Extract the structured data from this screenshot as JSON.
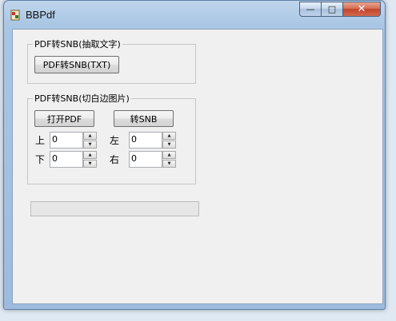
{
  "window": {
    "title": "BBPdf",
    "min": "—",
    "max": "□",
    "close": "✕"
  },
  "group1": {
    "legend": "PDF转SNB(抽取文字)",
    "button": "PDF转SNB(TXT)"
  },
  "group2": {
    "legend": "PDF转SNB(切白边图片)",
    "open_button": "打开PDF",
    "convert_button": "转SNB",
    "top_label": "上",
    "top_value": "0",
    "left_label": "左",
    "left_value": "0",
    "bottom_label": "下",
    "bottom_value": "0",
    "right_label": "右",
    "right_value": "0",
    "spin_up": "▲",
    "spin_down": "▼"
  },
  "progress": {
    "value": 0
  }
}
